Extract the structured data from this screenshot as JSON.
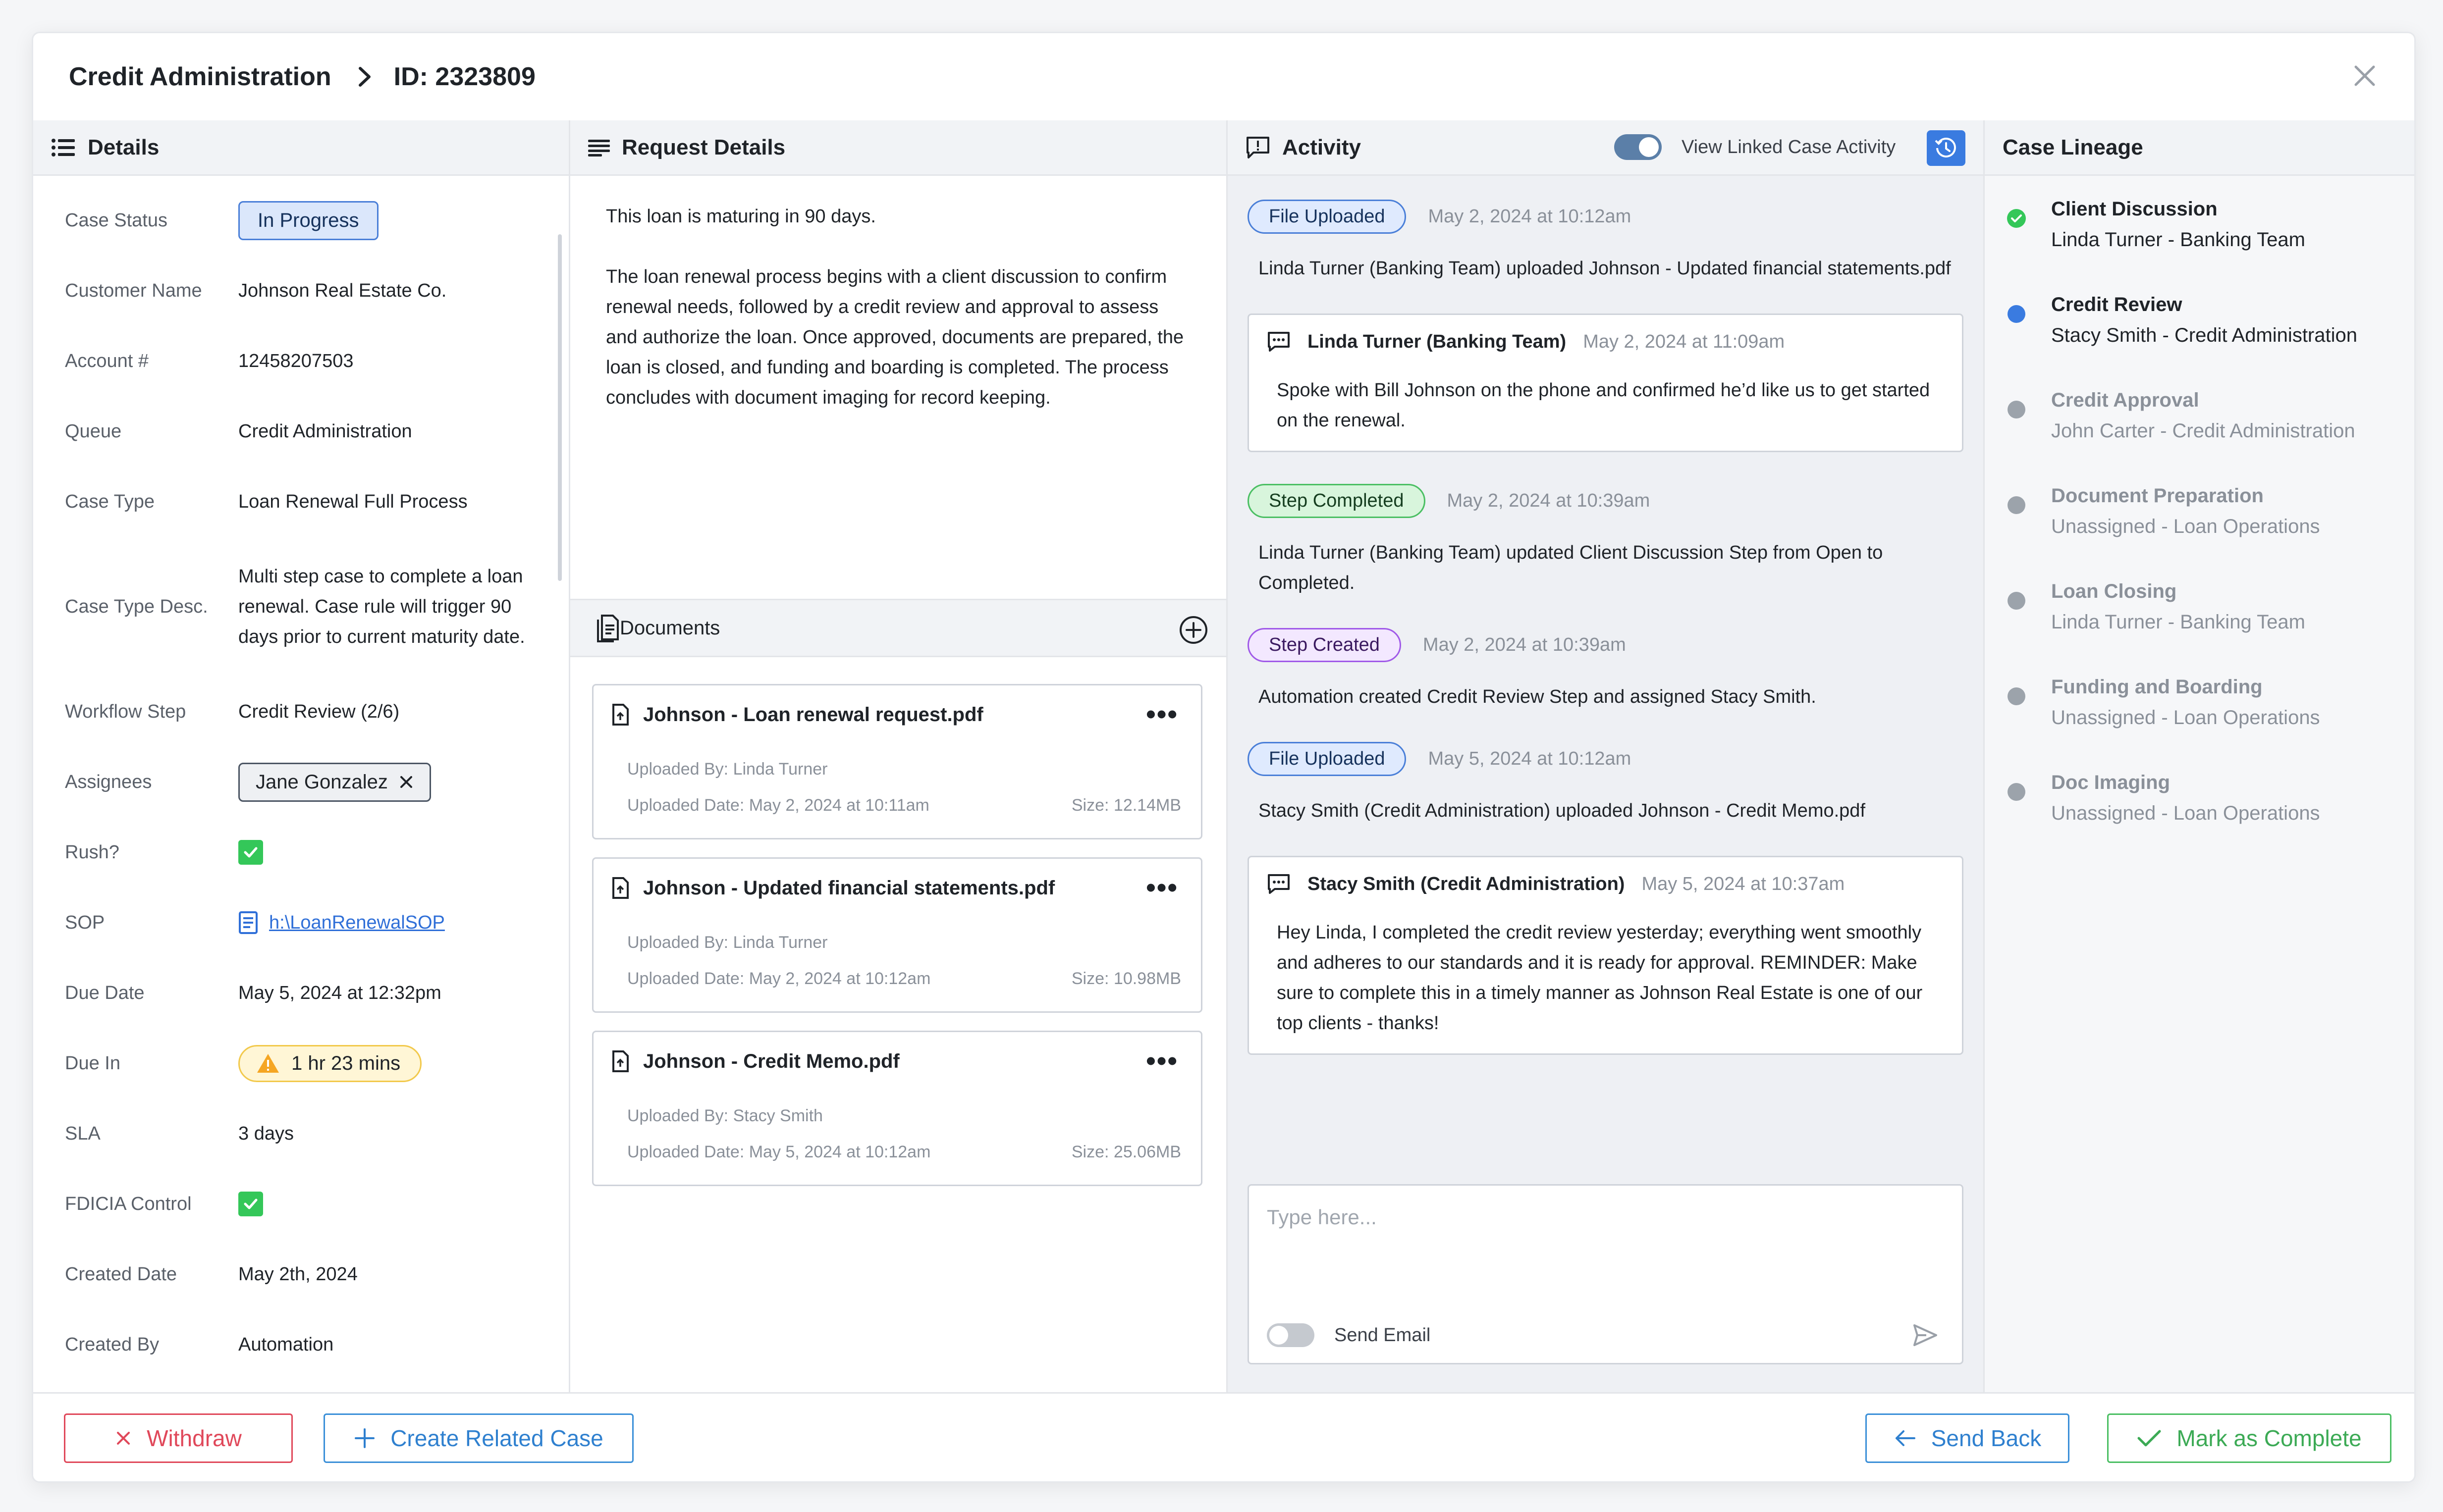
{
  "header": {
    "breadcrumb_root": "Credit Administration",
    "breadcrumb_id": "ID: 2323809"
  },
  "details": {
    "title": "Details",
    "fields": {
      "case_status": {
        "label": "Case Status",
        "value": "In Progress"
      },
      "customer_name": {
        "label": "Customer Name",
        "value": "Johnson Real Estate Co."
      },
      "account": {
        "label": "Account #",
        "value": "12458207503"
      },
      "queue": {
        "label": "Queue",
        "value": "Credit Administration"
      },
      "case_type": {
        "label": "Case Type",
        "value": "Loan Renewal Full Process"
      },
      "case_type_desc": {
        "label": "Case Type Desc.",
        "value": "Multi step case to complete a loan renewal. Case rule will trigger 90 days prior to current maturity date."
      },
      "workflow_step": {
        "label": "Workflow Step",
        "value": "Credit Review (2/6)"
      },
      "assignees": {
        "label": "Assignees",
        "value": "Jane Gonzalez"
      },
      "rush": {
        "label": "Rush?",
        "checked": true
      },
      "sop": {
        "label": "SOP",
        "value": "h:\\LoanRenewalSOP"
      },
      "due_date": {
        "label": "Due Date",
        "value": "May 5, 2024 at 12:32pm"
      },
      "due_in": {
        "label": "Due In",
        "value": "1 hr 23 mins"
      },
      "sla": {
        "label": "SLA",
        "value": "3 days"
      },
      "fdicia": {
        "label": "FDICIA Control",
        "checked": true
      },
      "created_date": {
        "label": "Created Date",
        "value": "May 2th, 2024"
      },
      "created_by": {
        "label": "Created By",
        "value": "Automation"
      }
    }
  },
  "request": {
    "title": "Request Details",
    "para1": "This loan is maturing in 90 days.",
    "para2": "The loan renewal process begins with a client discussion to confirm renewal needs, followed by a credit review and approval to assess and authorize the loan. Once approved, documents are prepared, the loan is closed, and funding and boarding is completed. The process concludes with document imaging for record keeping."
  },
  "documents": {
    "title": "Documents",
    "items": [
      {
        "name": "Johnson - Loan renewal request.pdf",
        "uploaded_by": "Uploaded By: Linda Turner",
        "uploaded_date": "Uploaded Date: May 2, 2024 at 10:11am",
        "size": "Size: 12.14MB"
      },
      {
        "name": "Johnson - Updated financial statements.pdf",
        "uploaded_by": "Uploaded By: Linda Turner",
        "uploaded_date": "Uploaded Date: May 2, 2024 at 10:12am",
        "size": "Size: 10.98MB"
      },
      {
        "name": "Johnson - Credit Memo.pdf",
        "uploaded_by": "Uploaded By: Stacy Smith",
        "uploaded_date": "Uploaded Date: May 5, 2024 at 10:12am",
        "size": "Size: 25.06MB"
      }
    ]
  },
  "activity": {
    "title": "Activity",
    "toggle_label": "View Linked Case Activity",
    "toggle_on": true,
    "events": [
      {
        "tag": "File Uploaded",
        "time": "May 2, 2024 at 10:12am",
        "text": "Linda Turner (Banking Team) uploaded Johnson - Updated financial statements.pdf"
      },
      {
        "author": "Linda Turner (Banking Team)",
        "time": "May 2, 2024 at 11:09am",
        "text": "Spoke with Bill Johnson on the phone and confirmed he’d like us to get started on the renewal."
      },
      {
        "tag": "Step Completed",
        "time": "May 2, 2024 at 10:39am",
        "text": "Linda Turner (Banking Team) updated Client Discussion Step from Open to Completed."
      },
      {
        "tag": "Step Created",
        "time": "May 2, 2024 at 10:39am",
        "text": "Automation created Credit Review Step and assigned Stacy Smith."
      },
      {
        "tag": "File Uploaded",
        "time": "May 5, 2024 at 10:12am",
        "text": "Stacy Smith (Credit Administration) uploaded Johnson - Credit Memo.pdf"
      },
      {
        "author": "Stacy Smith (Credit Administration)",
        "time": "May 5, 2024 at 10:37am",
        "text": "Hey Linda, I completed the credit review yesterday; everything went smoothly and adheres to our standards and it is ready for approval. REMINDER: Make sure to complete this in a timely manner as Johnson Real Estate is one of our top clients - thanks!"
      }
    ],
    "compose_placeholder": "Type here...",
    "send_email_label": "Send Email"
  },
  "lineage": {
    "title": "Case Lineage",
    "steps": [
      {
        "name": "Client Discussion",
        "owner": "Linda Turner - Banking Team",
        "state": "done"
      },
      {
        "name": "Credit Review",
        "owner": "Stacy Smith - Credit Administration",
        "state": "current"
      },
      {
        "name": "Credit Approval",
        "owner": "John Carter - Credit Administration",
        "state": "future"
      },
      {
        "name": "Document Preparation",
        "owner": "Unassigned - Loan Operations",
        "state": "future"
      },
      {
        "name": "Loan Closing",
        "owner": "Linda Turner - Banking Team",
        "state": "future"
      },
      {
        "name": "Funding and Boarding",
        "owner": "Unassigned - Loan Operations",
        "state": "future"
      },
      {
        "name": "Doc Imaging",
        "owner": "Unassigned - Loan Operations",
        "state": "future"
      }
    ]
  },
  "footer": {
    "withdraw": "Withdraw",
    "create_related": "Create Related Case",
    "send_back": "Send Back",
    "mark_complete": "Mark as Complete"
  },
  "colors": {
    "accent_blue": "#3a7be0",
    "success": "#34c759",
    "danger": "#e0485a",
    "warning": "#f2c94c"
  },
  "icons": [
    "list-icon",
    "lines-icon",
    "comment-alert-icon",
    "history-icon",
    "document-icon",
    "add-circle-icon",
    "file-icon",
    "chat-icon",
    "send-icon",
    "close-icon",
    "arrow-left-icon",
    "check-icon",
    "plus-icon",
    "warning-icon"
  ]
}
